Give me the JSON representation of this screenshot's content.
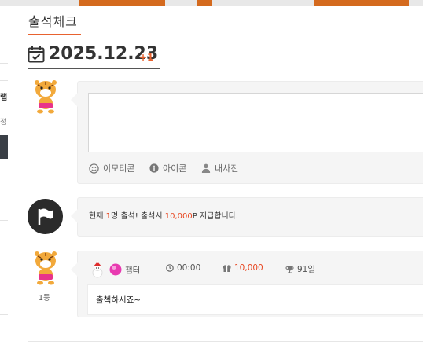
{
  "tab": {
    "label": "출석체크"
  },
  "date": {
    "value": "2025.12.23",
    "badge": "+1"
  },
  "sidebar_fragments": {
    "text_1": "랩",
    "text_2": "정"
  },
  "composer": {
    "placeholder": "",
    "tools": [
      {
        "icon": "smile-icon",
        "label": "이모티콘"
      },
      {
        "icon": "info-icon",
        "label": "아이콘"
      },
      {
        "icon": "user-icon",
        "label": "내사진"
      }
    ]
  },
  "notice": {
    "prefix": "현재 ",
    "count": "1",
    "middle": "명 출석! 출석시 ",
    "points": "10,000",
    "suffix": "P 지급합니다."
  },
  "entry": {
    "rank": "1등",
    "username": "챔터",
    "time": "00:00",
    "points": "10,000",
    "days": "91일",
    "message": "출첵하시죠~"
  },
  "colors": {
    "accent": "#e8622f",
    "points_red": "#e8451f"
  }
}
